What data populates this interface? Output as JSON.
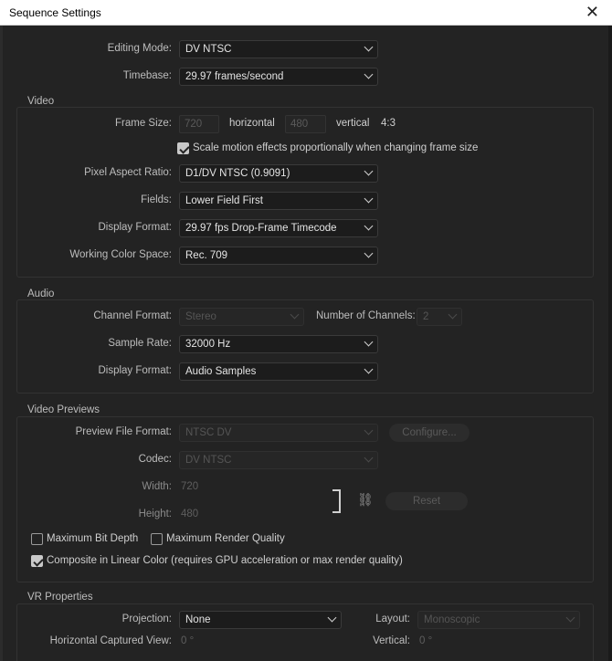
{
  "window": {
    "title": "Sequence Settings",
    "close_glyph": "✕"
  },
  "general": {
    "editing_mode": {
      "label": "Editing Mode:",
      "value": "DV NTSC"
    },
    "timebase": {
      "label": "Timebase:",
      "value": "29.97  frames/second"
    }
  },
  "video": {
    "title": "Video",
    "frame_size": {
      "label": "Frame Size:",
      "width": "720",
      "horizontal_label": "horizontal",
      "height": "480",
      "vertical_label": "vertical",
      "ratio": "4:3"
    },
    "scale_motion": {
      "label": "Scale motion effects proportionally when changing frame size",
      "checked": true
    },
    "pixel_aspect": {
      "label": "Pixel Aspect Ratio:",
      "value": "D1/DV NTSC (0.9091)"
    },
    "fields": {
      "label": "Fields:",
      "value": "Lower Field First"
    },
    "display_format": {
      "label": "Display Format:",
      "value": "29.97 fps Drop-Frame Timecode"
    },
    "color_space": {
      "label": "Working Color Space:",
      "value": "Rec. 709"
    }
  },
  "audio": {
    "title": "Audio",
    "channel_format": {
      "label": "Channel Format:",
      "value": "Stereo"
    },
    "num_channels": {
      "label": "Number of Channels:",
      "value": "2"
    },
    "sample_rate": {
      "label": "Sample Rate:",
      "value": "32000 Hz"
    },
    "display_format": {
      "label": "Display Format:",
      "value": "Audio Samples"
    }
  },
  "previews": {
    "title": "Video Previews",
    "file_format": {
      "label": "Preview File Format:",
      "value": "NTSC DV"
    },
    "configure_label": "Configure...",
    "codec": {
      "label": "Codec:",
      "value": "DV NTSC"
    },
    "width": {
      "label": "Width:",
      "value": "720"
    },
    "height": {
      "label": "Height:",
      "value": "480"
    },
    "reset_label": "Reset",
    "max_bit_depth": {
      "label": "Maximum Bit Depth",
      "checked": false
    },
    "max_render_quality": {
      "label": "Maximum Render Quality",
      "checked": false
    },
    "composite_linear": {
      "label": "Composite in Linear Color (requires GPU acceleration or max render quality)",
      "checked": true
    }
  },
  "vr": {
    "title": "VR Properties",
    "projection": {
      "label": "Projection:",
      "value": "None"
    },
    "layout": {
      "label": "Layout:",
      "value": "Monoscopic"
    },
    "h_captured": {
      "label": "Horizontal Captured View:",
      "value": "0 °"
    },
    "vertical": {
      "label": "Vertical:",
      "value": "0 °"
    }
  },
  "icons": {
    "link": "link-icon",
    "chevron": "chevron-down-icon",
    "check": "checkmark-icon"
  }
}
